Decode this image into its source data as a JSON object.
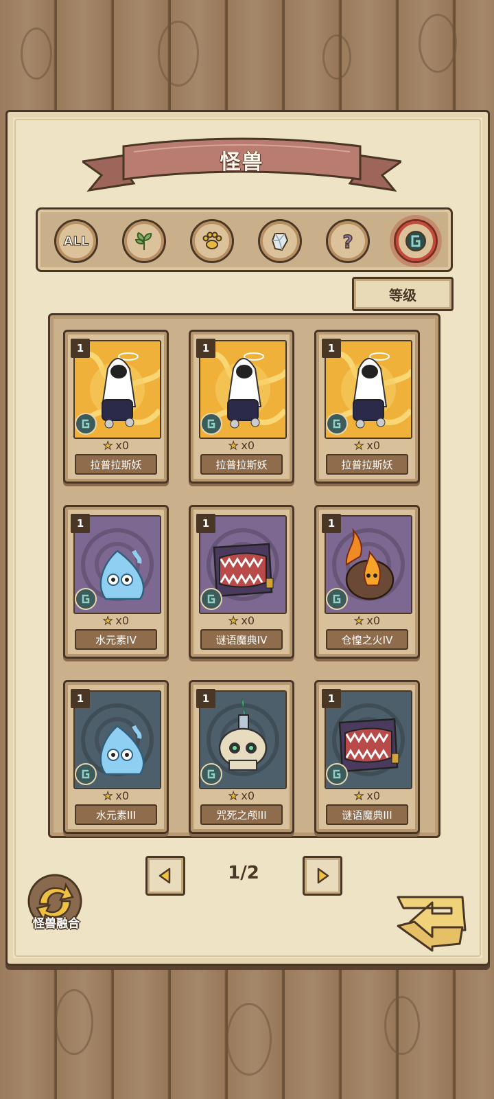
{
  "screen": {
    "title": "怪兽"
  },
  "filters": [
    {
      "id": "all",
      "label": "ALL",
      "icon": "all-text-icon",
      "active": false
    },
    {
      "id": "plant",
      "label": "",
      "icon": "leaf-icon",
      "active": false
    },
    {
      "id": "beast",
      "label": "",
      "icon": "paw-icon",
      "active": false
    },
    {
      "id": "crystal",
      "label": "",
      "icon": "crystal-icon",
      "active": false
    },
    {
      "id": "mystery",
      "label": "",
      "icon": "question-icon",
      "active": false
    },
    {
      "id": "rune",
      "label": "",
      "icon": "rune-icon",
      "active": true
    }
  ],
  "sort": {
    "label": "等级"
  },
  "cards": [
    {
      "level": "1",
      "name": "拉普拉斯妖",
      "count": "x0",
      "art": "laplace-demon",
      "bg": "yellow"
    },
    {
      "level": "1",
      "name": "拉普拉斯妖",
      "count": "x0",
      "art": "laplace-demon",
      "bg": "yellow"
    },
    {
      "level": "1",
      "name": "拉普拉斯妖",
      "count": "x0",
      "art": "laplace-demon",
      "bg": "yellow"
    },
    {
      "level": "1",
      "name": "水元素IV",
      "count": "x0",
      "art": "water-slime",
      "bg": "purple"
    },
    {
      "level": "1",
      "name": "谜语魔典IV",
      "count": "x0",
      "art": "mimic-book",
      "bg": "purple"
    },
    {
      "level": "1",
      "name": "仓惶之火IV",
      "count": "x0",
      "art": "fire-spirit",
      "bg": "purple"
    },
    {
      "level": "1",
      "name": "水元素III",
      "count": "x0",
      "art": "water-slime",
      "bg": "slate"
    },
    {
      "level": "1",
      "name": "咒死之颅III",
      "count": "x0",
      "art": "candle-skull",
      "bg": "slate"
    },
    {
      "level": "1",
      "name": "谜语魔典III",
      "count": "x0",
      "art": "mimic-book",
      "bg": "slate"
    }
  ],
  "pagination": {
    "text": "1/2"
  },
  "fusion": {
    "label": "怪兽融合"
  },
  "colors": {
    "ink": "#4a3624",
    "banner": "#b97c70",
    "paper": "#efe3c6",
    "bg_yellow": "#f0b13a",
    "bg_purple": "#7d6891",
    "bg_slate": "#4d5f6b"
  }
}
